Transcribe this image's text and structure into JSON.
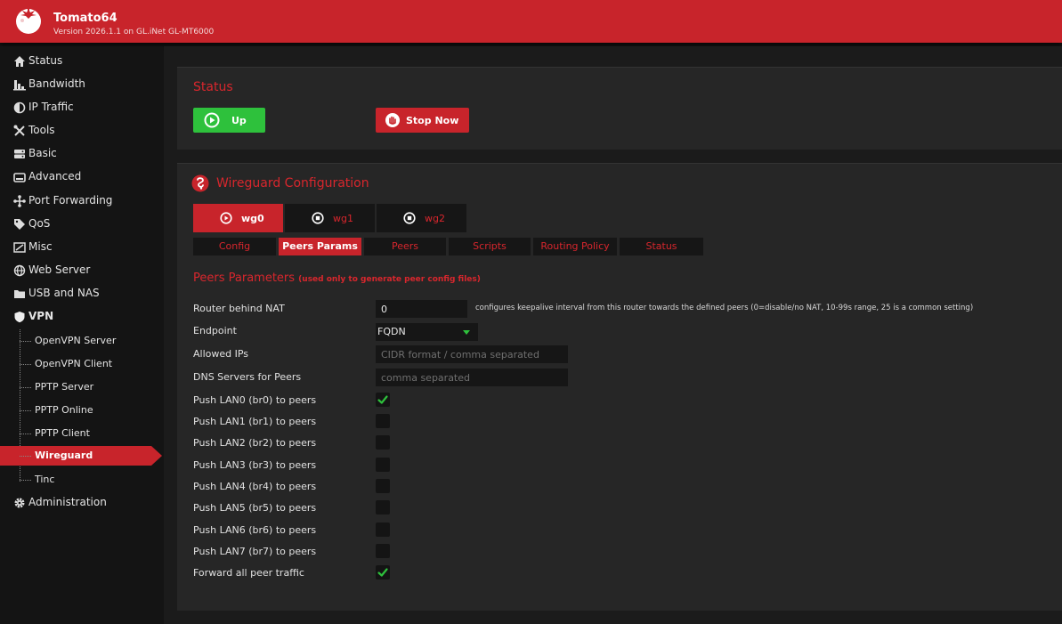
{
  "header": {
    "title": "Tomato64",
    "subtitle": "Version 2026.1.1 on GL.iNet GL-MT6000"
  },
  "sidebar": {
    "items": [
      {
        "label": "Status",
        "icon": "home-icon"
      },
      {
        "label": "Bandwidth",
        "icon": "bar-chart-icon"
      },
      {
        "label": "IP Traffic",
        "icon": "pie-chart-icon"
      },
      {
        "label": "Tools",
        "icon": "tools-icon"
      },
      {
        "label": "Basic",
        "icon": "server-icon"
      },
      {
        "label": "Advanced",
        "icon": "router-icon"
      },
      {
        "label": "Port Forwarding",
        "icon": "network-icon"
      },
      {
        "label": "QoS",
        "icon": "tag-icon"
      },
      {
        "label": "Misc",
        "icon": "misc-icon"
      },
      {
        "label": "Web Server",
        "icon": "globe-icon"
      },
      {
        "label": "USB and NAS",
        "icon": "folder-icon"
      },
      {
        "label": "VPN",
        "icon": "shield-icon"
      }
    ],
    "vpn_items": [
      {
        "label": "OpenVPN Server"
      },
      {
        "label": "OpenVPN Client"
      },
      {
        "label": "PPTP Server"
      },
      {
        "label": "PPTP Online"
      },
      {
        "label": "PPTP Client"
      },
      {
        "label": "Wireguard"
      },
      {
        "label": "Tinc"
      }
    ],
    "admin": {
      "label": "Administration",
      "icon": "gear-icon"
    }
  },
  "status": {
    "title": "Status",
    "up_label": "Up",
    "stop_label": "Stop Now"
  },
  "wireguard": {
    "title": "Wireguard Configuration",
    "tabs": [
      {
        "label": "wg0"
      },
      {
        "label": "wg1"
      },
      {
        "label": "wg2"
      }
    ],
    "subtabs": [
      {
        "label": "Config"
      },
      {
        "label": "Peers Params"
      },
      {
        "label": "Peers"
      },
      {
        "label": "Scripts"
      },
      {
        "label": "Routing Policy"
      },
      {
        "label": "Status"
      }
    ]
  },
  "peers": {
    "title": "Peers Parameters",
    "note": "(used only to generate peer config files)",
    "router_nat": {
      "label": "Router behind NAT",
      "value": "0",
      "hint": "configures keepalive interval from this router towards the defined peers (0=disable/no NAT, 10-99s range, 25 is a common setting)"
    },
    "endpoint": {
      "label": "Endpoint",
      "value": "FQDN"
    },
    "allowed_ips": {
      "label": "Allowed IPs",
      "placeholder": "CIDR format / comma separated"
    },
    "dns": {
      "label": "DNS Servers for Peers",
      "placeholder": "comma separated"
    },
    "checks": [
      {
        "label": "Push LAN0 (br0) to peers",
        "checked": true
      },
      {
        "label": "Push LAN1 (br1) to peers",
        "checked": false
      },
      {
        "label": "Push LAN2 (br2) to peers",
        "checked": false
      },
      {
        "label": "Push LAN3 (br3) to peers",
        "checked": false
      },
      {
        "label": "Push LAN4 (br4) to peers",
        "checked": false
      },
      {
        "label": "Push LAN5 (br5) to peers",
        "checked": false
      },
      {
        "label": "Push LAN6 (br6) to peers",
        "checked": false
      },
      {
        "label": "Push LAN7 (br7) to peers",
        "checked": false
      },
      {
        "label": "Forward all peer traffic",
        "checked": true
      }
    ]
  },
  "colors": {
    "brand_red": "#c8242b",
    "accent_green": "#2ec13c",
    "panel_bg": "#262626"
  }
}
